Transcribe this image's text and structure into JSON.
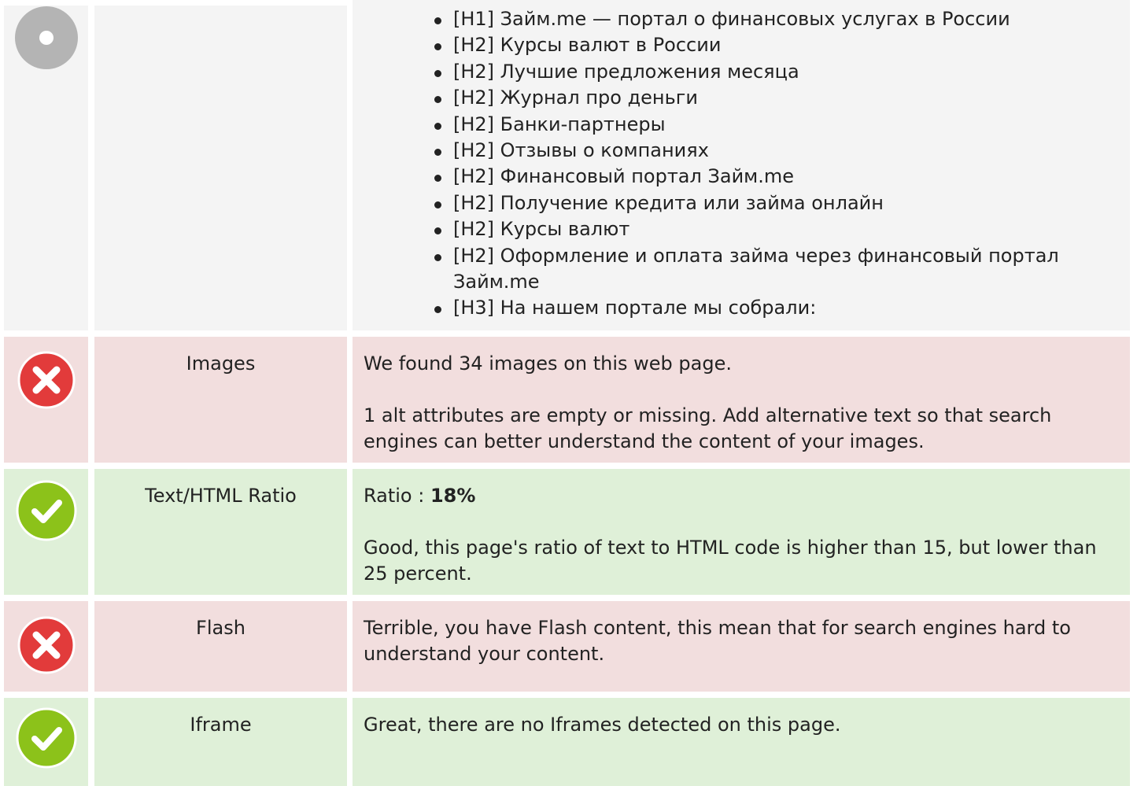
{
  "headings_row": {
    "items": [
      "[H1] Займ.me — портал о финансовых услугах в России",
      "[H2] Курсы валют в России",
      "[H2] Лучшие предложения месяца",
      "[H2] Журнал про деньги",
      "[H2] Банки-партнеры",
      "[H2] Отзывы о компаниях",
      "[H2] Финансовый портал Займ.me",
      "[H2] Получение кредита или займа онлайн",
      "[H2] Курсы валют",
      "[H2] Оформление и оплата займа через финансовый портал Займ.me",
      "[H3] На нашем портале мы собрали:"
    ]
  },
  "images": {
    "status_icon": "error-x-icon",
    "title": "Images",
    "line1": "We found 34 images on this web page.",
    "line2": "1 alt attributes are empty or missing. Add alternative text so that search engines can better understand the content of your images."
  },
  "ratio": {
    "status_icon": "check-icon",
    "title": "Text/HTML Ratio",
    "ratio_label": "Ratio : ",
    "ratio_value": "18%",
    "line2": "Good, this page's ratio of text to HTML code is higher than 15, but lower than 25 percent."
  },
  "flash": {
    "status_icon": "error-x-icon",
    "title": "Flash",
    "line1": "Terrible, you have Flash content, this mean that for search engines hard to understand your content."
  },
  "iframe": {
    "status_icon": "check-icon",
    "title": "Iframe",
    "line1": "Great, there are no Iframes detected on this page."
  },
  "colors": {
    "error_red": "#e23b3b",
    "success_green": "#8cc21a",
    "neutral_gray": "#b4b4b4",
    "bad_bg": "#f2dede",
    "good_bg": "#dff0d8"
  }
}
